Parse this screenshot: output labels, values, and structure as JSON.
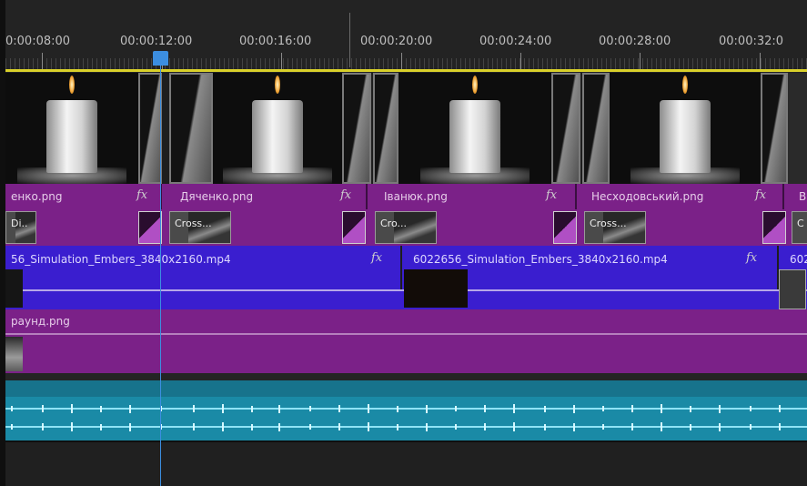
{
  "ruler": {
    "timecodes": [
      "00:00:08:00",
      "00:00:12:00",
      "00:00:16:00",
      "00:00:20:00",
      "00:00:24:00",
      "00:00:28:00",
      "00:00:32:00"
    ],
    "first_label_visible": "0:00:08:00",
    "last_label_visible": "00:00:32:0"
  },
  "playhead": {
    "timecode": "00:00:12:00"
  },
  "track_v2": {
    "clips": [
      {
        "label": "енко.png",
        "fx": "fx"
      },
      {
        "label": "Дяченко.png",
        "fx": "fx"
      },
      {
        "label": "Іванюк.png",
        "fx": "fx"
      },
      {
        "label": "Несходовський.png",
        "fx": "fx"
      },
      {
        "label": "В"
      }
    ],
    "transitions": [
      "Di..",
      "Cross...",
      "Cro...",
      "Cross...",
      "C"
    ]
  },
  "track_v1": {
    "clips": [
      {
        "label": "56_Simulation_Embers_3840x2160.mp4",
        "fx": "fx"
      },
      {
        "label": "6022656_Simulation_Embers_3840x2160.mp4",
        "fx": "fx"
      },
      {
        "label": "602"
      }
    ]
  },
  "track_bg": {
    "label": "раунд.png"
  },
  "colors": {
    "image_clip": "#7b2188",
    "video_clip": "#3a1ecf",
    "audio_clip": "#1a8aa6",
    "playhead": "#3c8ee0",
    "work_area": "#d9d02a"
  },
  "icons": [
    "playhead-handle-icon",
    "transition-icon",
    "fx-badge-icon"
  ]
}
